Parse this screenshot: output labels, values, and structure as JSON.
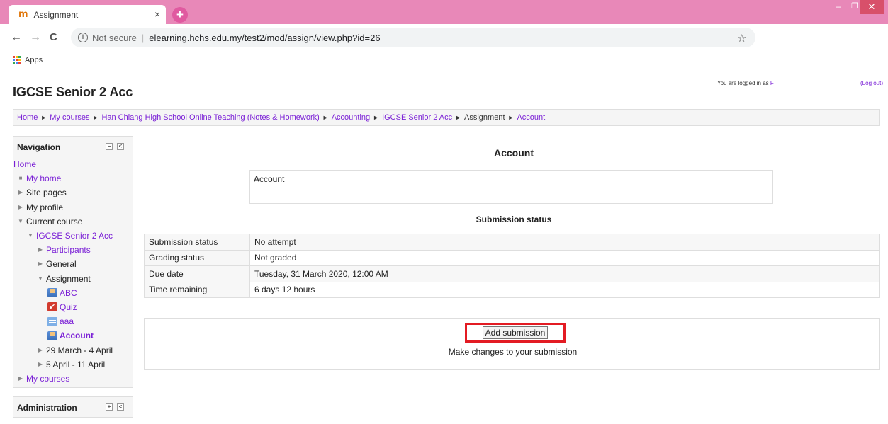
{
  "browser": {
    "tab_title": "Assignment",
    "tab_close": "×",
    "new_tab": "+",
    "min": "–",
    "restore": "❐",
    "close": "✕",
    "back": "←",
    "forward": "→",
    "reload": "C",
    "info_glyph": "i",
    "not_secure": "Not secure",
    "separator": "|",
    "url": "elearning.hchs.edu.my/test2/mod/assign/view.php?id=26",
    "star": "☆",
    "bookmarks_apps": "Apps"
  },
  "header": {
    "site_title": "IGCSE Senior 2 Acc",
    "logged_in_text": "You are logged in as",
    "user_name": "F",
    "logout": "(Log out)"
  },
  "breadcrumb": {
    "items": [
      "Home",
      "My courses",
      "Han Chiang High School Online Teaching (Notes & Homework)",
      "Accounting",
      "IGCSE Senior 2 Acc",
      "Assignment",
      "Account"
    ],
    "arrow": "►"
  },
  "navigation": {
    "title": "Navigation",
    "items": [
      "Home",
      "My home",
      "Site pages",
      "My profile",
      "Current course",
      "IGCSE Senior 2 Acc",
      "Participants",
      "General",
      "Assignment",
      "ABC",
      "Quiz",
      "aaa",
      "Account",
      "29 March - 4 April",
      "5 April - 11 April",
      "My courses"
    ],
    "glyphs": {
      "bullet": "■",
      "collapsed": "▶",
      "expanded": "▼",
      "dock": "<",
      "minimize": "−",
      "expand": "+"
    }
  },
  "administration": {
    "title": "Administration"
  },
  "main": {
    "title": "Account",
    "intro": "Account",
    "submission_title": "Submission status",
    "rows": [
      {
        "key": "Submission status",
        "value": "No attempt"
      },
      {
        "key": "Grading status",
        "value": "Not graded"
      },
      {
        "key": "Due date",
        "value": "Tuesday, 31 March 2020, 12:00 AM"
      },
      {
        "key": "Time remaining",
        "value": "6 days 12 hours"
      }
    ],
    "add_submission": "Add submission",
    "make_changes": "Make changes to your submission"
  },
  "colors": {
    "tabbar": "#e888b8",
    "link": "#7a1fd6",
    "highlight": "#e31b23"
  }
}
